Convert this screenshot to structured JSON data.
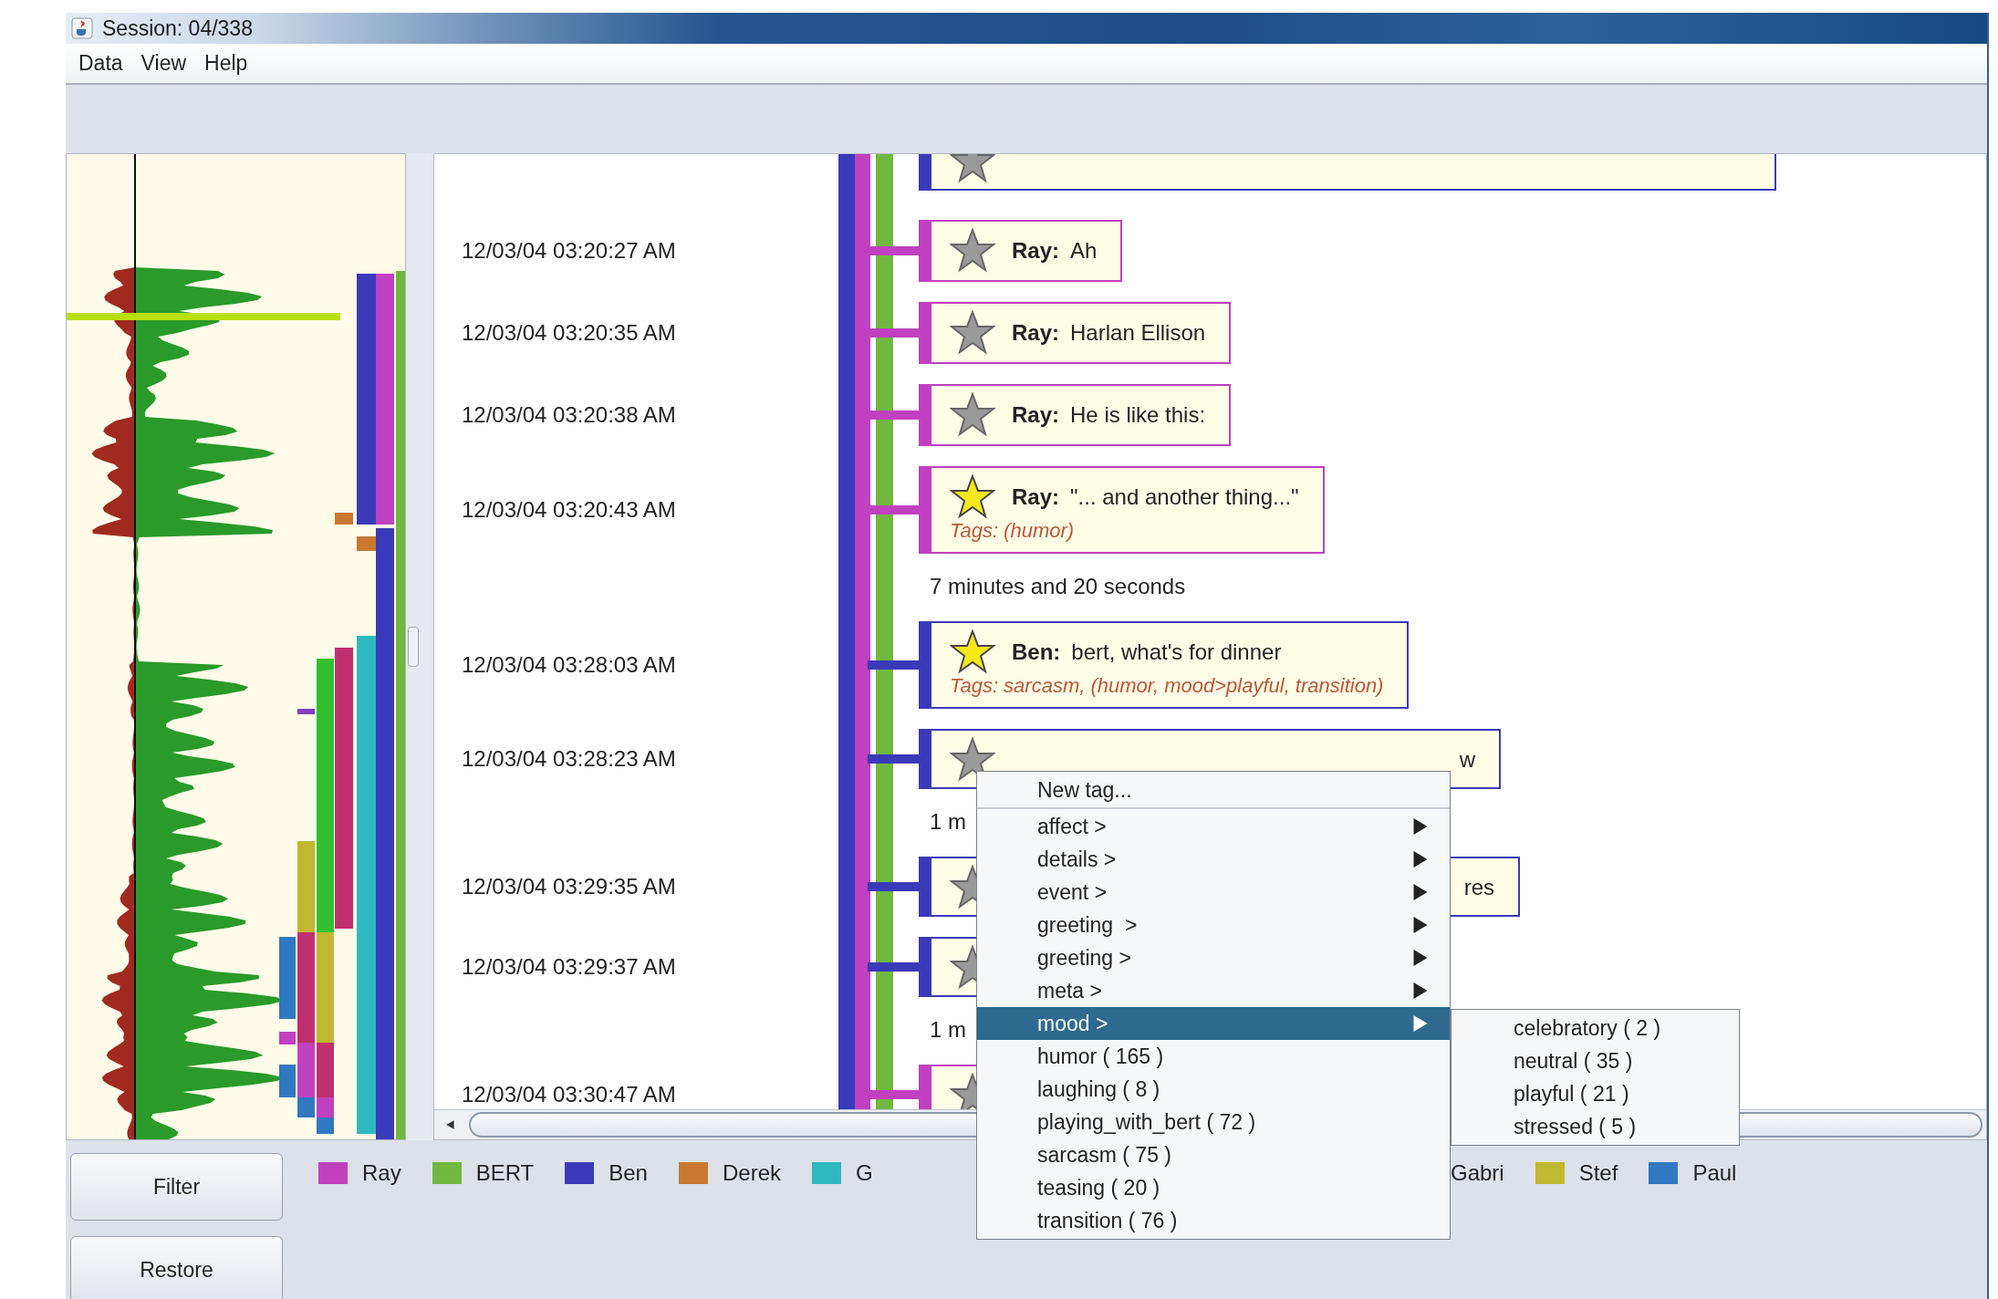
{
  "window": {
    "title": "Session: 04/338"
  },
  "menu_bar": [
    "Data",
    "View",
    "Help"
  ],
  "timeline": [
    {
      "kind": "cut",
      "color": "#3a3ab8",
      "starred": false
    },
    {
      "kind": "message",
      "time": "12/03/04 03:20:27 AM",
      "color": "#c040c0",
      "starred": false,
      "speaker": "Ray:",
      "text": "Ah"
    },
    {
      "kind": "message",
      "time": "12/03/04 03:20:35 AM",
      "color": "#c040c0",
      "starred": false,
      "speaker": "Ray:",
      "text": "Harlan Ellison"
    },
    {
      "kind": "message",
      "time": "12/03/04 03:20:38 AM",
      "color": "#c040c0",
      "starred": false,
      "speaker": "Ray:",
      "text": "He is like this:"
    },
    {
      "kind": "message",
      "time": "12/03/04 03:20:43 AM",
      "color": "#c040c0",
      "starred": true,
      "speaker": "Ray:",
      "text": "\"... and another thing...\"",
      "tags": "Tags: (humor)"
    },
    {
      "kind": "gap",
      "text": "7 minutes and 20 seconds"
    },
    {
      "kind": "message",
      "time": "12/03/04 03:28:03 AM",
      "color": "#3a3ab8",
      "starred": true,
      "speaker": "Ben:",
      "text": "bert, what's for dinner",
      "tags": "Tags: sarcasm, (humor, mood>playful, transition)"
    },
    {
      "kind": "covered",
      "time": "12/03/04 03:28:23 AM",
      "color": "#3a3ab8",
      "starred": false,
      "text": "w"
    },
    {
      "kind": "gap",
      "text": "1 m"
    },
    {
      "kind": "covered",
      "time": "12/03/04 03:29:35 AM",
      "color": "#3a3ab8",
      "starred": false,
      "text": "res"
    },
    {
      "kind": "covered",
      "time": "12/03/04 03:29:37 AM",
      "color": "#3a3ab8",
      "starred": false
    },
    {
      "kind": "gap",
      "text": "1 m"
    },
    {
      "kind": "covered",
      "time": "12/03/04 03:30:47 AM",
      "color": "#c040c0",
      "starred": false
    }
  ],
  "buttons": [
    "Filter",
    "Restore"
  ],
  "legend": [
    {
      "label": "Ray",
      "color": "#c040c0"
    },
    {
      "label": "BERT",
      "color": "#70b840"
    },
    {
      "label": "Ben",
      "color": "#3a3ab8"
    },
    {
      "label": "Derek",
      "color": "#c87830"
    },
    {
      "label": "G",
      "color": "#30b8c0"
    }
  ],
  "legend_after_menu": [
    {
      "label": "Gabri"
    },
    {
      "label": "Stef",
      "color": "#c0b830"
    },
    {
      "label": "Paul",
      "color": "#3078c0"
    }
  ],
  "context_menu": {
    "items": [
      {
        "label": "New tag...",
        "kind": "action",
        "selected": false
      },
      {
        "label": "affect >",
        "kind": "submenu",
        "selected": false
      },
      {
        "label": "details >",
        "kind": "submenu",
        "selected": false
      },
      {
        "label": "event >",
        "kind": "submenu",
        "selected": false
      },
      {
        "label": "greeting  >",
        "kind": "submenu",
        "selected": false
      },
      {
        "label": "greeting >",
        "kind": "submenu",
        "selected": false
      },
      {
        "label": "meta >",
        "kind": "submenu",
        "selected": false
      },
      {
        "label": "mood >",
        "kind": "submenu",
        "selected": true
      },
      {
        "label": "humor ( 165 )",
        "kind": "tag",
        "selected": false
      },
      {
        "label": "laughing ( 8 )",
        "kind": "tag",
        "selected": false
      },
      {
        "label": "playing_with_bert ( 72 )",
        "kind": "tag",
        "selected": false
      },
      {
        "label": "sarcasm ( 75 )",
        "kind": "tag",
        "selected": false
      },
      {
        "label": "teasing ( 20 )",
        "kind": "tag",
        "selected": false
      },
      {
        "label": "transition ( 76 )",
        "kind": "tag",
        "selected": false
      }
    ],
    "submenu": [
      {
        "label": "celebratory ( 2 )",
        "selected": false
      },
      {
        "label": "neutral ( 35 )",
        "selected": false
      },
      {
        "label": "playful ( 21 )",
        "selected": false
      },
      {
        "label": "stressed ( 5 )",
        "selected": false
      }
    ]
  }
}
